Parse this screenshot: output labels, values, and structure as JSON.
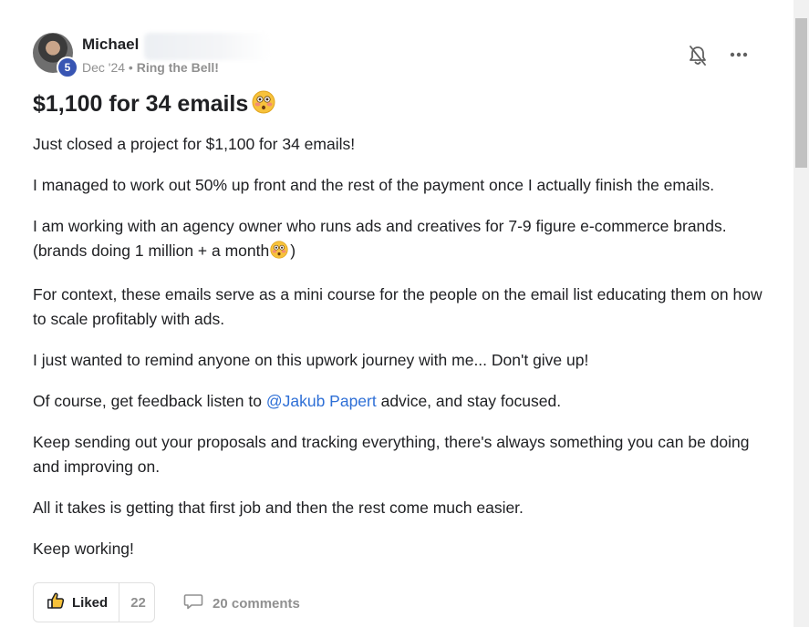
{
  "post": {
    "author": {
      "name": "Michael",
      "level": "5",
      "date": "Dec '24",
      "separator": "•",
      "category": "Ring the Bell!"
    },
    "title": "$1,100 for 34 emails",
    "paragraphs": {
      "p1": "Just closed a project for $1,100 for 34 emails!",
      "p2": "I managed to work out 50% up front and the rest of the payment once I actually finish the emails.",
      "p3a": "I am working with an agency owner who runs ads and creatives for 7-9 figure e-commerce brands. (brands doing 1 million + a month",
      "p3b": ")",
      "p4": "For context, these emails serve as a mini course for the people on the email list educating them on how to scale profitably with ads.",
      "p5": "I just wanted to remind anyone on this upwork journey with me... Don't give up!",
      "p6a": "Of course, get feedback listen to ",
      "p6_mention": "@Jakub Papert",
      "p6b": " advice, and stay focused.",
      "p7": "Keep sending out your proposals and tracking everything, there's always something you can be doing and improving on.",
      "p8": "All it takes is getting that first job and then the rest come much easier.",
      "p9": "Keep working!"
    },
    "actions": {
      "like_label": "Liked",
      "like_count": "22",
      "comments_label": "20 comments"
    },
    "icons": {
      "bell": "bell-off-icon",
      "more": "more-horizontal-icon",
      "like": "thumbs-up-icon",
      "comment": "comment-icon",
      "emoji": "flushed-face-emoji"
    },
    "colors": {
      "mention": "#2e6fd6",
      "level_badge": "#3855b3",
      "muted": "#909090"
    }
  }
}
